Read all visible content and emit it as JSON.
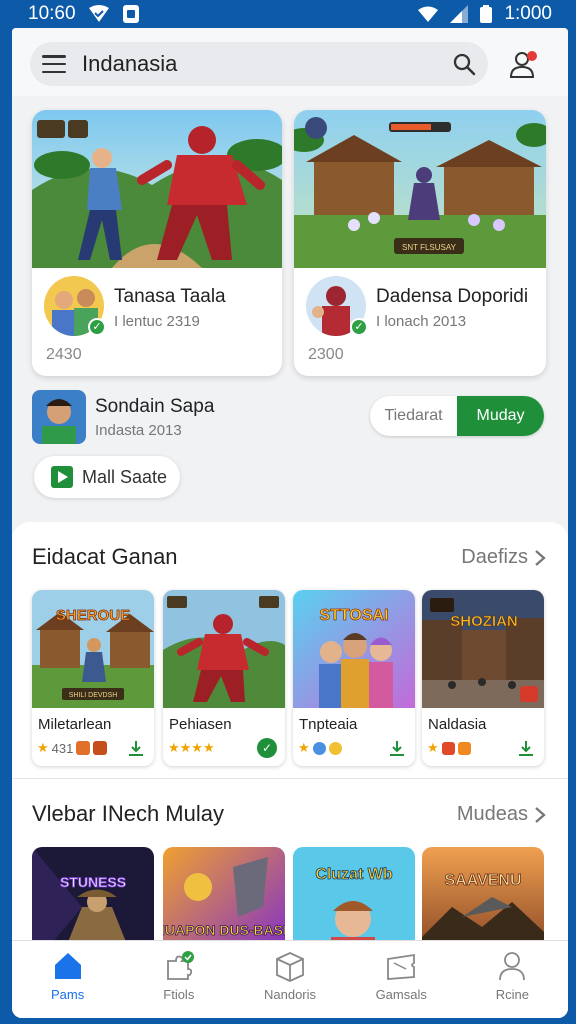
{
  "status_bar": {
    "time_left": "10:60",
    "time_right": "1:000",
    "icons_left": [
      "wifi-shield-icon",
      "sim-icon"
    ],
    "icons_right": [
      "wifi-icon",
      "signal-icon",
      "battery-icon"
    ]
  },
  "header": {
    "search_title": "Indanasia",
    "menu_icon": "menu-icon",
    "search_icon": "search-icon",
    "profile_icon": "profile-alert-icon"
  },
  "featured": [
    {
      "name": "Tanasa Taala",
      "sub": "I lentuc 2319",
      "count": "2430"
    },
    {
      "name": "Dadensa Doporidi",
      "sub": "I lonach 2013",
      "count": "2300"
    }
  ],
  "featured_art_label": "SNT FLSUSAY",
  "small_item": {
    "name": "Sondain Sapa",
    "sub": "Indasta 2013"
  },
  "segment": {
    "options": [
      "Tiedarat",
      "Muday"
    ],
    "active": 1
  },
  "chip": {
    "label": "Mall Saate",
    "icon": "play-icon"
  },
  "section1": {
    "title": "Eidacat Ganan",
    "more": "Daefizs",
    "tiles": [
      {
        "name": "Miletarlean",
        "meta": "431",
        "art_label": "SHEROUE",
        "art_sub": "SHILI DEVDSH",
        "action_icon": "download-icon"
      },
      {
        "name": "Pehiasen",
        "meta": "★★★★",
        "art_label": "",
        "action_icon": "installed-check-icon"
      },
      {
        "name": "Tnpteaia",
        "meta": "",
        "art_label": "STTOSAI",
        "action_icon": "download-icon"
      },
      {
        "name": "Naldasia",
        "meta": "",
        "art_label": "SHOZIAN",
        "action_icon": "download-icon"
      }
    ]
  },
  "section2": {
    "title": "Vlebar INech  Mulay",
    "more": "Mudeas",
    "tiles": [
      {
        "art_label": "STUNESS"
      },
      {
        "art_label": "NUAPON DUS-BASN"
      },
      {
        "art_label": "Cluzat Wb"
      },
      {
        "art_label": "SAAVENU"
      }
    ]
  },
  "bottom_nav": {
    "active": 0,
    "items": [
      {
        "label": "Pams",
        "icon": "home-icon"
      },
      {
        "label": "Ftiols",
        "icon": "puzzle-icon"
      },
      {
        "label": "Nandoris",
        "icon": "box-icon"
      },
      {
        "label": "Gamsals",
        "icon": "ticket-icon"
      },
      {
        "label": "Rcine",
        "icon": "person-icon"
      }
    ]
  },
  "colors": {
    "status_bar": "#0d5aa8",
    "accent_green": "#1f8f3a",
    "active_nav": "#1a73e8"
  }
}
